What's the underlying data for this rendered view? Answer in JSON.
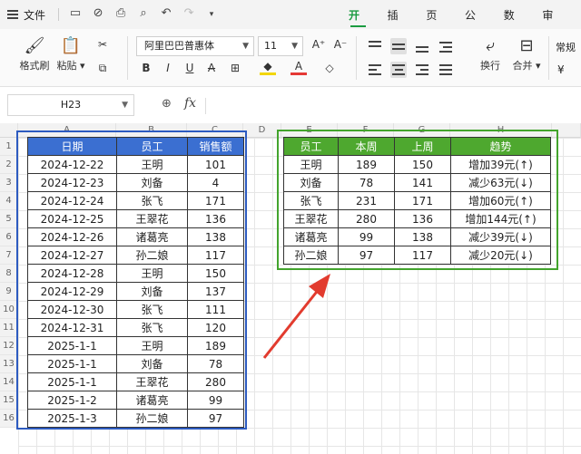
{
  "menu": {
    "file_label": "文件",
    "tabs": [
      "开始",
      "插入",
      "页面",
      "公式",
      "数据",
      "审阅"
    ],
    "active_tab": "开始"
  },
  "ribbon": {
    "format_painter": "格式刷",
    "paste": "粘贴",
    "font_name": "阿里巴巴普惠体",
    "font_size": "11",
    "wrap": "换行",
    "merge": "合并",
    "normal": "常规",
    "currency": "¥"
  },
  "formula_bar": {
    "cell_ref": "H23",
    "fx_label": "fx",
    "content": ""
  },
  "columns": [
    "A",
    "B",
    "C",
    "D",
    "E",
    "F",
    "G",
    "H"
  ],
  "rows": [
    "1",
    "2",
    "3",
    "4",
    "5",
    "6",
    "7",
    "8",
    "9",
    "10",
    "11",
    "12",
    "13",
    "14",
    "15",
    "16"
  ],
  "table1": {
    "headers": [
      "日期",
      "员工",
      "销售额"
    ],
    "rows": [
      [
        "2024-12-22",
        "王明",
        "101"
      ],
      [
        "2024-12-23",
        "刘备",
        "4"
      ],
      [
        "2024-12-24",
        "张飞",
        "171"
      ],
      [
        "2024-12-25",
        "王翠花",
        "136"
      ],
      [
        "2024-12-26",
        "诸葛亮",
        "138"
      ],
      [
        "2024-12-27",
        "孙二娘",
        "117"
      ],
      [
        "2024-12-28",
        "王明",
        "150"
      ],
      [
        "2024-12-29",
        "刘备",
        "137"
      ],
      [
        "2024-12-30",
        "张飞",
        "111"
      ],
      [
        "2024-12-31",
        "张飞",
        "120"
      ],
      [
        "2025-1-1",
        "王明",
        "189"
      ],
      [
        "2025-1-1",
        "刘备",
        "78"
      ],
      [
        "2025-1-1",
        "王翠花",
        "280"
      ],
      [
        "2025-1-2",
        "诸葛亮",
        "99"
      ],
      [
        "2025-1-3",
        "孙二娘",
        "97"
      ]
    ]
  },
  "table2": {
    "headers": [
      "员工",
      "本周",
      "上周",
      "趋势"
    ],
    "rows": [
      [
        "王明",
        "189",
        "150",
        "增加39元(↑)"
      ],
      [
        "刘备",
        "78",
        "141",
        "减少63元(↓)"
      ],
      [
        "张飞",
        "231",
        "171",
        "增加60元(↑)"
      ],
      [
        "王翠花",
        "280",
        "136",
        "增加144元(↑)"
      ],
      [
        "诸葛亮",
        "99",
        "138",
        "减少39元(↓)"
      ],
      [
        "孙二娘",
        "97",
        "117",
        "减少20元(↓)"
      ]
    ]
  },
  "colors": {
    "accent_green": "#1a9b40",
    "table1_header": "#3b6fd1",
    "table2_header": "#4ea82f",
    "arrow": "#e23b2e"
  }
}
